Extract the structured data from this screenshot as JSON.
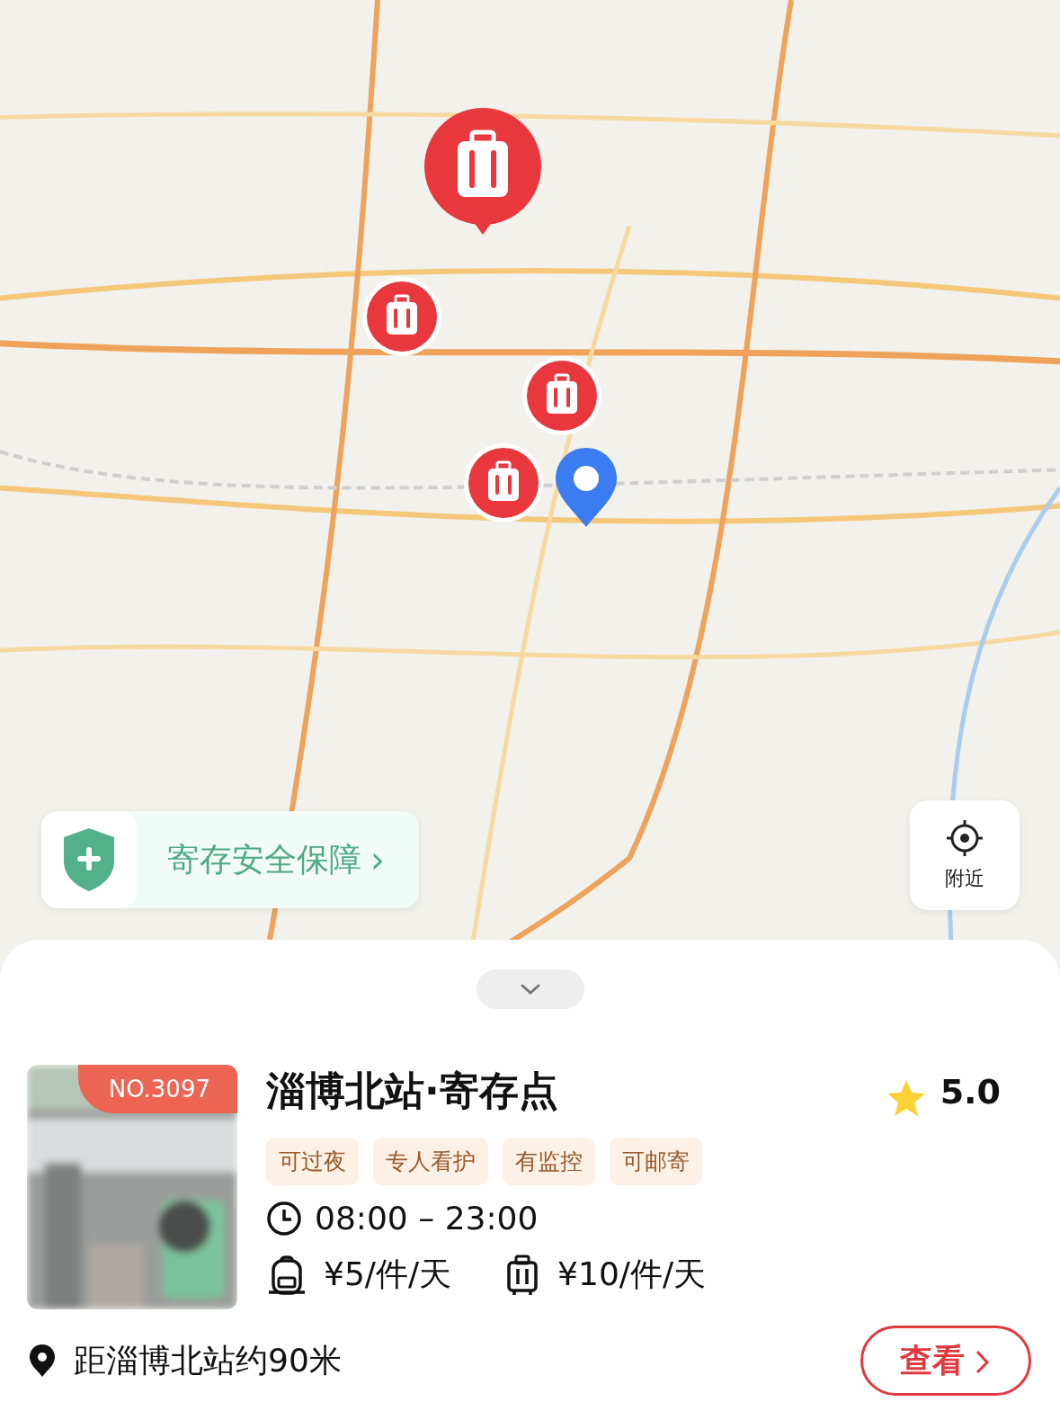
{
  "map": {
    "markers": [
      {
        "kind": "featured"
      },
      {
        "kind": "luggage"
      },
      {
        "kind": "luggage"
      },
      {
        "kind": "luggage"
      },
      {
        "kind": "location"
      }
    ],
    "safety_banner": {
      "label": "寄存安全保障",
      "arrow": "›"
    },
    "nearby_button": {
      "label": "附近"
    }
  },
  "sheet": {
    "store": {
      "badge": "NO.3097",
      "name": "淄博北站·寄存点",
      "rating": "5.0",
      "tags": [
        "可过夜",
        "专人看护",
        "有监控",
        "可邮寄"
      ],
      "hours": "08:00 – 23:00",
      "prices": [
        {
          "kind": "backpack",
          "text": "¥5/件/天"
        },
        {
          "kind": "suitcase",
          "text": "¥10/件/天"
        }
      ],
      "distance": "距淄博北站约90米",
      "view_button": "查看"
    }
  }
}
